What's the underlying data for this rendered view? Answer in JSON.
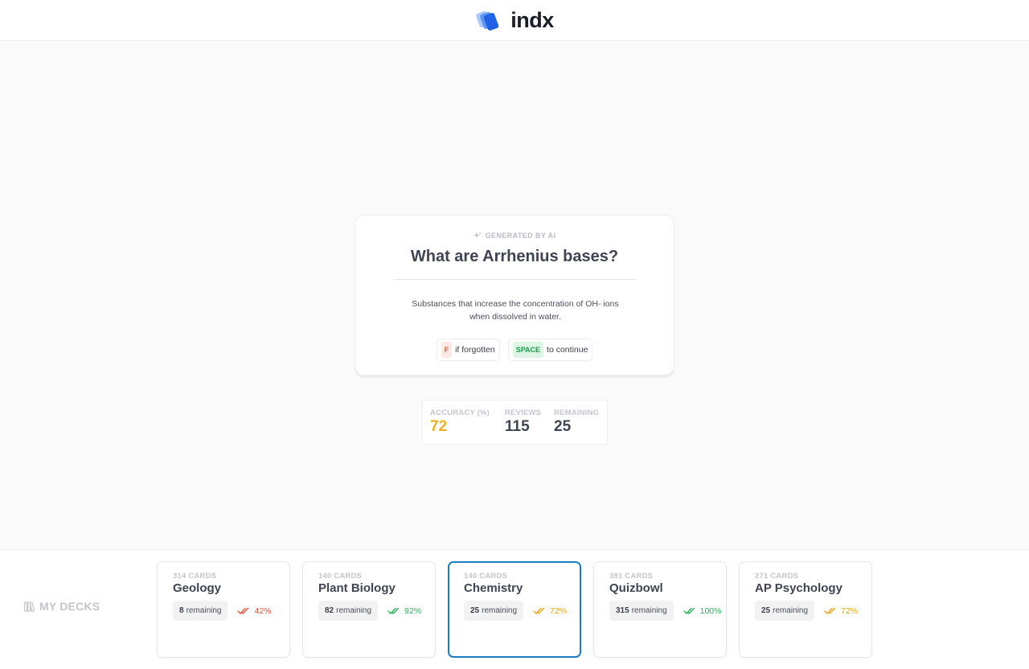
{
  "header": {
    "brand": "indx"
  },
  "flashcard": {
    "tag": "GENERATED BY AI",
    "question": "What are Arrhenius bases?",
    "answer": "Substances that increase the concentration of OH- ions when dissolved in water.",
    "hints": [
      {
        "key": "F",
        "text": "if forgotten"
      },
      {
        "key": "SPACE",
        "text": "to continue"
      }
    ]
  },
  "stats": {
    "accuracy": {
      "label": "ACCURACY (%)",
      "value": "72"
    },
    "reviews": {
      "label": "REVIEWS",
      "value": "115"
    },
    "remaining": {
      "label": "REMAINING",
      "value": "25"
    }
  },
  "decks_section": {
    "title": "MY DECKS"
  },
  "decks": [
    {
      "count_label": "314 CARDS",
      "name": "Geology",
      "remaining": "8",
      "remaining_label": "remaining",
      "accuracy": "42%",
      "accuracy_color": "#e0533b",
      "active": false
    },
    {
      "count_label": "140 CARDS",
      "name": "Plant Biology",
      "remaining": "82",
      "remaining_label": "remaining",
      "accuracy": "92%",
      "accuracy_color": "#22b358",
      "active": false
    },
    {
      "count_label": "140 CARDS",
      "name": "Chemistry",
      "remaining": "25",
      "remaining_label": "remaining",
      "accuracy": "72%",
      "accuracy_color": "#e6a817",
      "active": true
    },
    {
      "count_label": "391 CARDS",
      "name": "Quizbowl",
      "remaining": "315",
      "remaining_label": "remaining",
      "accuracy": "100%",
      "accuracy_color": "#22b358",
      "active": false
    },
    {
      "count_label": "271 CARDS",
      "name": "AP Psychology",
      "remaining": "25",
      "remaining_label": "remaining",
      "accuracy": "72%",
      "accuracy_color": "#e6a817",
      "active": false
    }
  ],
  "colors": {
    "accent": "#1b7ec4",
    "accuracy_stat": "#ecb321",
    "forgot_key_bg": "#fde8e4",
    "space_key_bg": "#dcf5e4"
  },
  "icons": {
    "logo": "indx-logo-icon",
    "ai": "sparkle-icon",
    "decks": "books-icon",
    "accuracy": "double-check-icon"
  }
}
